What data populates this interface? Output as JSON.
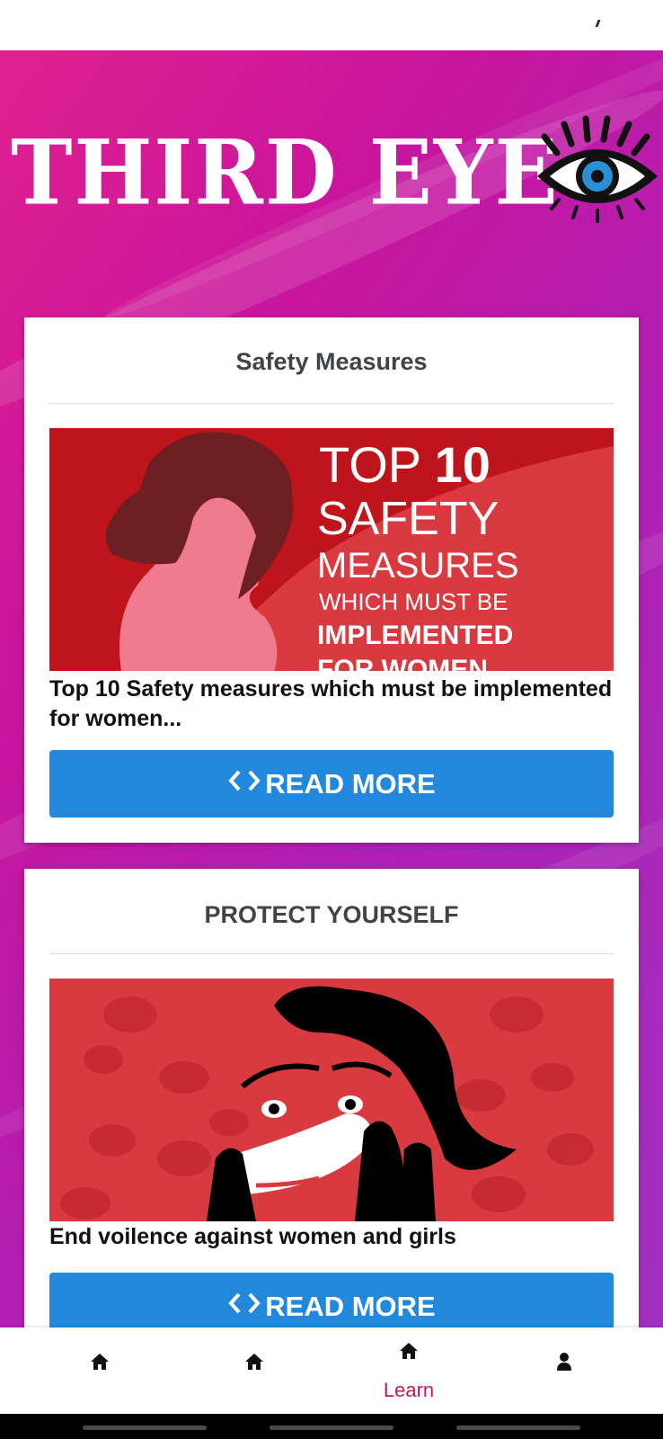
{
  "app": {
    "title": "THIRD EYE",
    "colors": {
      "gradient_start": "#e0208f",
      "gradient_end": "#a030c0",
      "button": "#2188dc",
      "active_nav": "#c2185b"
    }
  },
  "cards": [
    {
      "title": "Safety Measures",
      "image_text": {
        "line1a": "TOP",
        "line1b": "10",
        "line2": "SAFETY",
        "line3": "MEASURES",
        "line4": "WHICH MUST BE",
        "line5": "IMPLEMENTED",
        "line6": "FOR WOMEN"
      },
      "caption": "Top 10 Safety measures which must be implemented for women...",
      "button_label": "READ MORE",
      "button_icon": "code-icon"
    },
    {
      "title": "PROTECT YOURSELF",
      "caption": "End voilence against women and girls",
      "button_label": "READ MORE",
      "button_icon": "code-icon"
    }
  ],
  "bottom_nav": [
    {
      "icon": "home-icon",
      "label": ""
    },
    {
      "icon": "home-icon",
      "label": ""
    },
    {
      "icon": "home-icon",
      "label": "Learn",
      "active": true
    },
    {
      "icon": "user-icon",
      "label": ""
    }
  ]
}
